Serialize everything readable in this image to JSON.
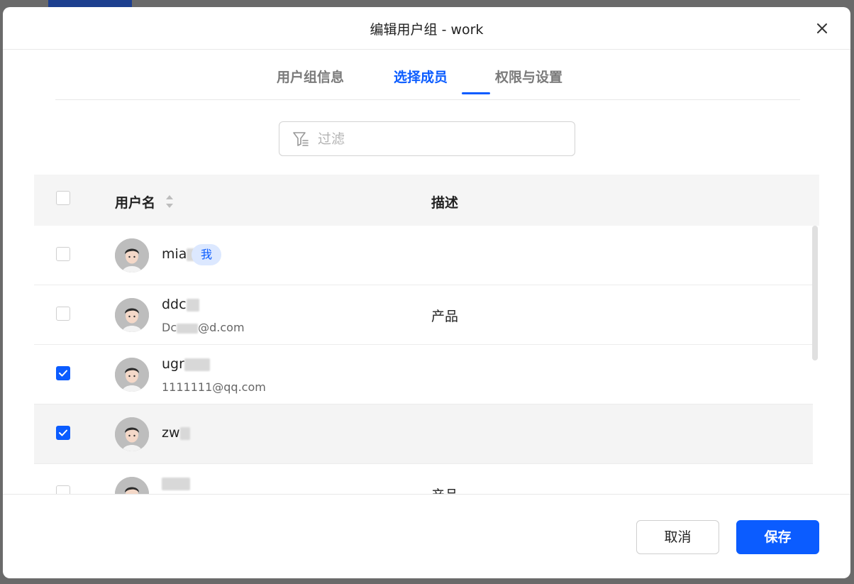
{
  "dialog": {
    "title": "编辑用户组 - work"
  },
  "tabs": [
    {
      "label": "用户组信息",
      "active": false
    },
    {
      "label": "选择成员",
      "active": true
    },
    {
      "label": "权限与设置",
      "active": false
    }
  ],
  "filter": {
    "placeholder": "过滤",
    "value": ""
  },
  "table": {
    "columns": {
      "username": "用户名",
      "description": "描述"
    },
    "rows": [
      {
        "username": "mia",
        "me_badge": "我",
        "email": "",
        "description": "",
        "checked": false
      },
      {
        "username": "ddc",
        "me_badge": "",
        "email": "Dc",
        "email_suffix": "@d.com",
        "description": "产品",
        "checked": false
      },
      {
        "username": "ugr",
        "me_badge": "",
        "email": "1111111@qq.com",
        "description": "",
        "checked": true
      },
      {
        "username": "zw",
        "me_badge": "",
        "email": "",
        "description": "",
        "checked": true
      },
      {
        "username": "",
        "me_badge": "",
        "email": "",
        "description": "产品",
        "checked": false
      }
    ]
  },
  "footer": {
    "cancel_label": "取消",
    "save_label": "保存"
  },
  "colors": {
    "accent": "#0b5cff",
    "badge_bg": "#dce8ff"
  }
}
